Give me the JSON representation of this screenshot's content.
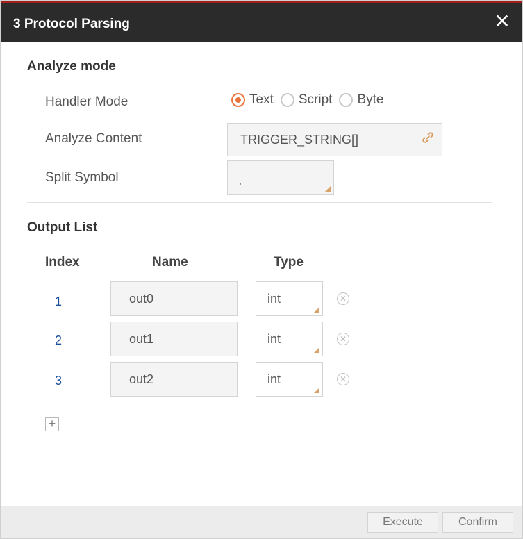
{
  "dialog": {
    "title": "3 Protocol Parsing",
    "close_icon": "close-icon"
  },
  "analyze": {
    "section_title": "Analyze mode",
    "handler_mode_label": "Handler Mode",
    "modes": [
      {
        "label": "Text",
        "selected": true
      },
      {
        "label": "Script",
        "selected": false
      },
      {
        "label": "Byte",
        "selected": false
      }
    ],
    "content_label": "Analyze Content",
    "content_value": "TRIGGER_STRING[]",
    "split_label": "Split Symbol",
    "split_value": ","
  },
  "output": {
    "section_title": "Output List",
    "headers": {
      "index": "Index",
      "name": "Name",
      "type": "Type"
    },
    "rows": [
      {
        "index": "1",
        "name": "out0",
        "type": "int"
      },
      {
        "index": "2",
        "name": "out1",
        "type": "int"
      },
      {
        "index": "3",
        "name": "out2",
        "type": "int"
      }
    ]
  },
  "footer": {
    "execute_label": "Execute",
    "confirm_label": "Confirm"
  },
  "colors": {
    "accent": "#e8743b",
    "titlebar": "#2b2b2b",
    "index_text": "#1a4f9a"
  }
}
